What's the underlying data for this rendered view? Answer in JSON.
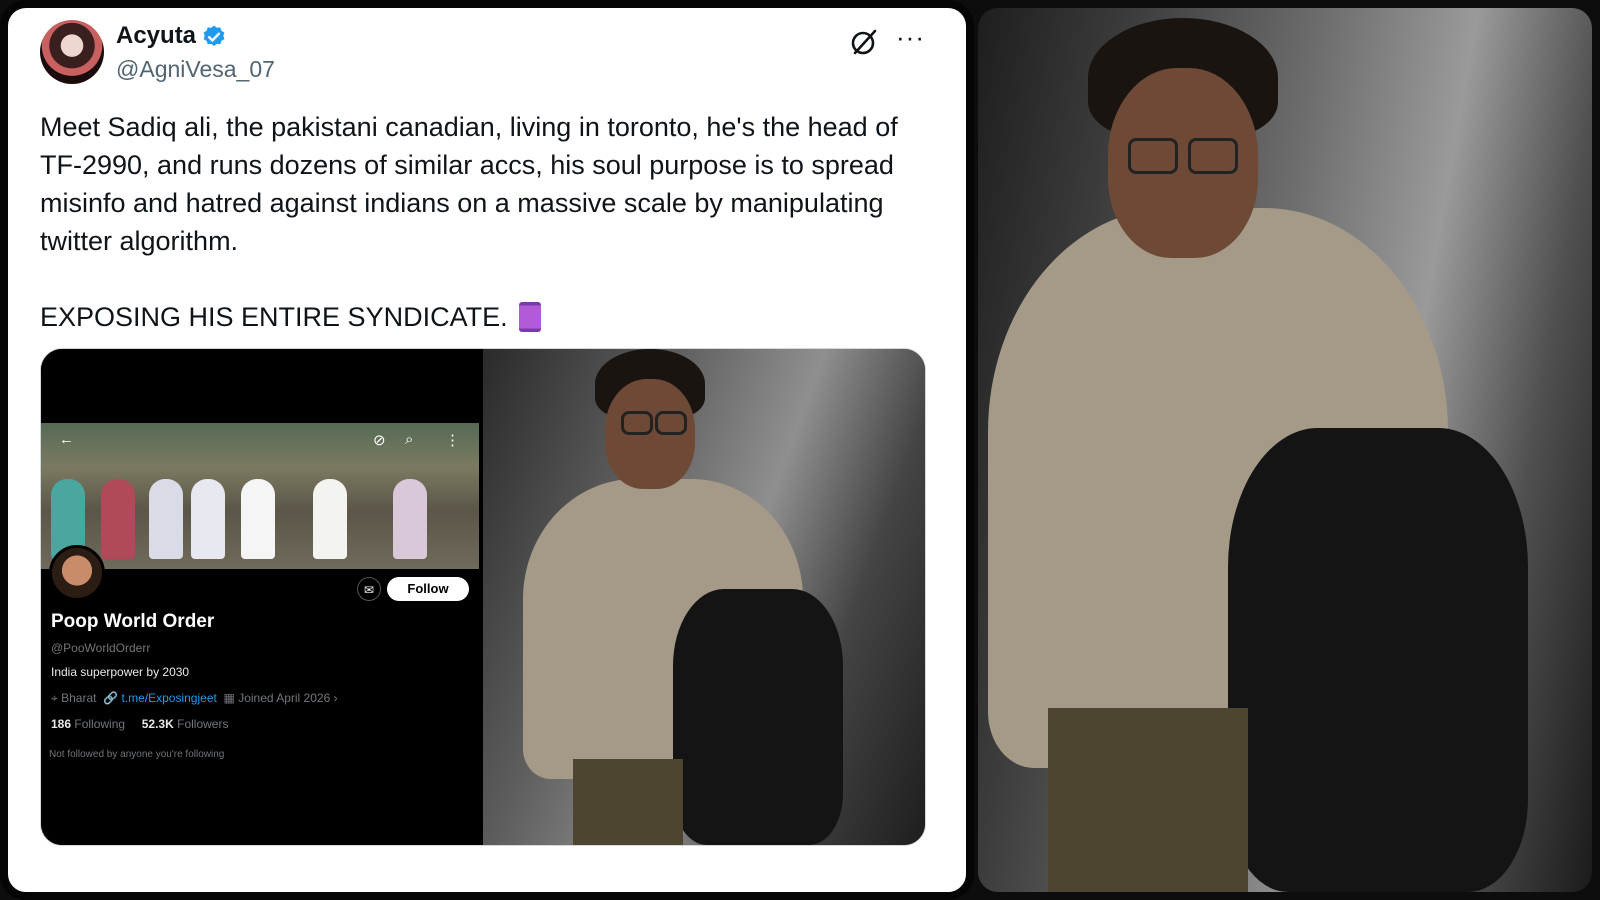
{
  "tweet": {
    "author_name": "Acyuta",
    "author_handle": "@AgniVesa_07",
    "text_paragraph_1": "Meet Sadiq ali, the pakistani canadian, living in toronto, he's the head of TF-2990, and runs dozens of similar accs, his soul purpose is to spread misinfo and hatred against indians on a massive scale by manipulating twitter algorithm.",
    "text_paragraph_2": "EXPOSING HIS ENTIRE SYNDICATE.",
    "more_glyph": "···"
  },
  "embedded_profile": {
    "name": "Poop World Order",
    "handle": "@PooWorldOrderr",
    "bio": "India superpower by 2030",
    "location": "Bharat",
    "link": "t.me/Exposingjeet",
    "joined": "Joined April 2026",
    "following_count": "186",
    "following_label": "Following",
    "followers_count": "52.3K",
    "followers_label": "Followers",
    "note": "Not followed by anyone you're following",
    "follow_label": "Follow",
    "mail_glyph": "✉"
  },
  "colors": {
    "verified": "#1d9bf0",
    "text": "#0f1419",
    "muted": "#536471",
    "link": "#1d9bf0"
  },
  "icons": [
    "verified-badge-icon",
    "grok-icon",
    "more-icon",
    "back-arrow-icon",
    "search-icon",
    "menu-icon",
    "mail-icon",
    "location-icon",
    "link-icon",
    "calendar-icon",
    "thread-emoji-icon"
  ]
}
